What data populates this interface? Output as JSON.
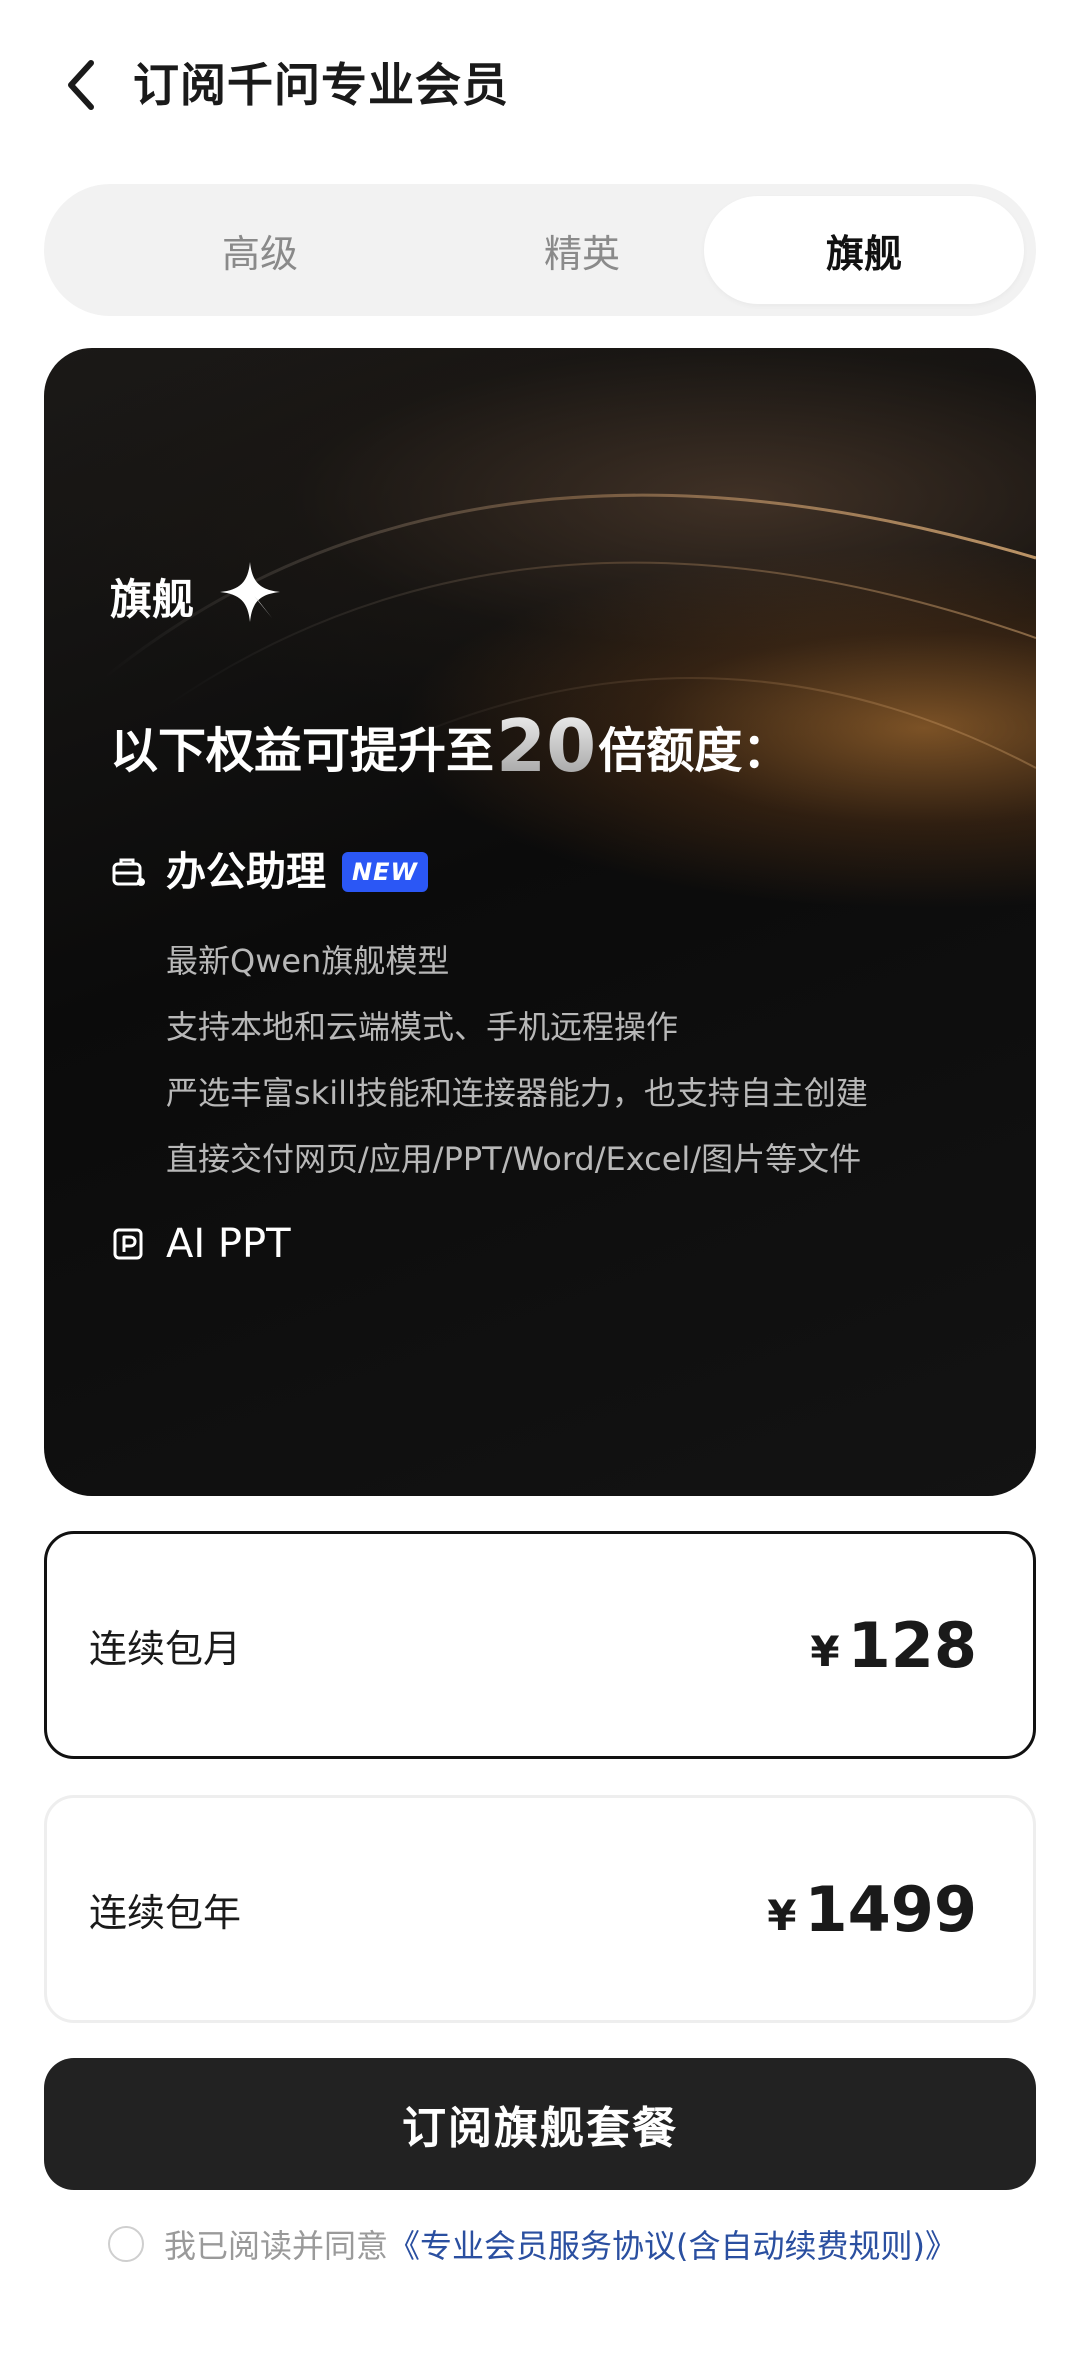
{
  "header": {
    "title": "订阅千问专业会员"
  },
  "tabs": [
    {
      "label": "高级",
      "selected": false
    },
    {
      "label": "精英",
      "selected": false
    },
    {
      "label": "旗舰",
      "selected": true
    }
  ],
  "hero": {
    "tier_name": "旗舰",
    "headline_prefix": "以下权益可提升至",
    "headline_multiplier": "20",
    "headline_suffix": "倍额度：",
    "features": [
      {
        "icon": "office-assistant-icon",
        "title": "办公助理",
        "badge": "NEW",
        "details": [
          "最新Qwen旗舰模型",
          "支持本地和云端模式、手机远程操作",
          "严选丰富skill技能和连接器能力，也支持自主创建",
          "直接交付网页/应用/PPT/Word/Excel/图片等文件"
        ]
      },
      {
        "icon": "ppt-icon",
        "title": "AI PPT"
      }
    ]
  },
  "plans": [
    {
      "label": "连续包月",
      "currency": "¥",
      "price": "128",
      "selected": true
    },
    {
      "label": "连续包年",
      "currency": "¥",
      "price": "1499",
      "selected": false
    }
  ],
  "subscribe": {
    "label": "订阅旗舰套餐"
  },
  "agreement": {
    "prefix": "我已阅读并同意",
    "link": "《专业会员服务协议(含自动续费规则)》",
    "checked": false
  },
  "colors": {
    "accent_link": "#2a4fa0",
    "badge": "#2b57f5",
    "button": "#222222"
  }
}
